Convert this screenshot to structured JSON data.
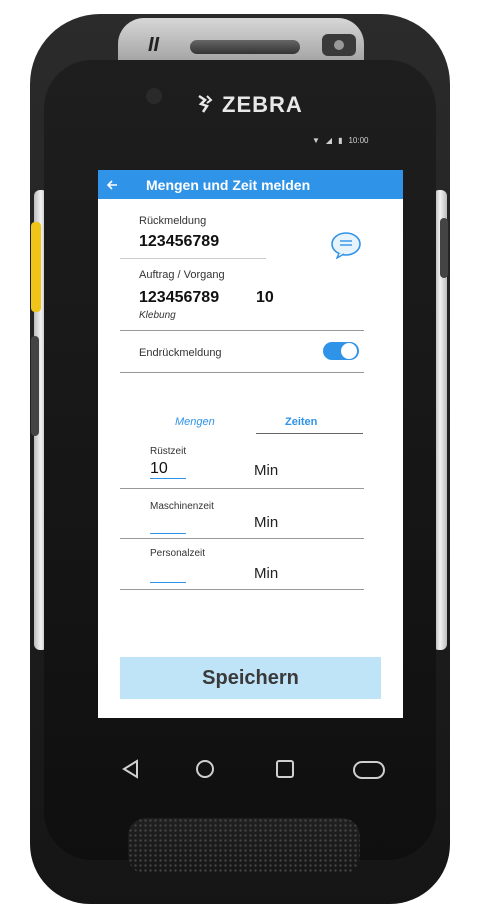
{
  "device": {
    "brand": "ZEBRA",
    "top_ident": "II",
    "status_time": "10:00"
  },
  "header": {
    "title": "Mengen und Zeit melden"
  },
  "confirmation": {
    "label": "Rückmeldung",
    "value": "123456789"
  },
  "order": {
    "label": "Auftrag / Vorgang",
    "order_number": "123456789",
    "operation": "10",
    "description": "Klebung"
  },
  "final_confirmation": {
    "label": "Endrückmeldung",
    "enabled": true
  },
  "tabs": [
    {
      "label": "Mengen",
      "active": false
    },
    {
      "label": "Zeiten",
      "active": true
    }
  ],
  "times": [
    {
      "label": "Rüstzeit",
      "value": "10",
      "unit": "Min"
    },
    {
      "label": "Maschinenzeit",
      "value": "",
      "unit": "Min"
    },
    {
      "label": "Personalzeit",
      "value": "",
      "unit": "Min"
    }
  ],
  "save_label": "Speichern",
  "colors": {
    "accent": "#2f93e8",
    "save_button": "#bfe3f7"
  },
  "icons": [
    "back-arrow-icon",
    "chat-icon",
    "wifi-icon",
    "signal-icon",
    "battery-icon",
    "nav-back-icon",
    "nav-home-icon",
    "nav-recent-icon"
  ]
}
